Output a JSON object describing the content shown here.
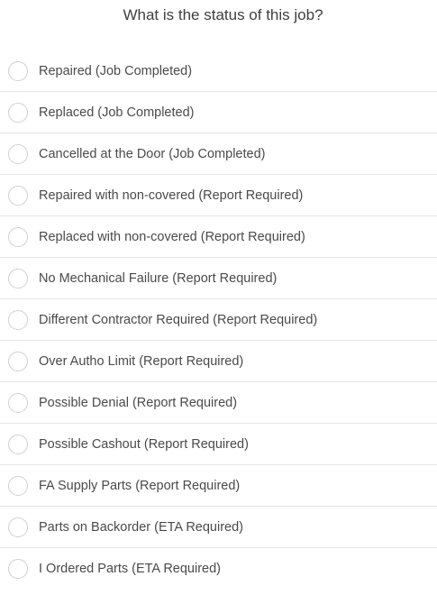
{
  "question": "What is the status of this job?",
  "options": [
    {
      "label": "Repaired (Job Completed)",
      "selected": false
    },
    {
      "label": "Replaced (Job Completed)",
      "selected": false
    },
    {
      "label": "Cancelled at the Door (Job Completed)",
      "selected": false
    },
    {
      "label": "Repaired with non-covered (Report Required)",
      "selected": false
    },
    {
      "label": "Replaced with non-covered (Report Required)",
      "selected": false
    },
    {
      "label": "No Mechanical Failure (Report Required)",
      "selected": false
    },
    {
      "label": "Different Contractor Required (Report Required)",
      "selected": false
    },
    {
      "label": "Over Autho Limit (Report Required)",
      "selected": false
    },
    {
      "label": "Possible Denial (Report Required)",
      "selected": false
    },
    {
      "label": "Possible Cashout (Report Required)",
      "selected": false
    },
    {
      "label": "FA Supply Parts (Report Required)",
      "selected": false
    },
    {
      "label": "Parts on Backorder (ETA Required)",
      "selected": false
    },
    {
      "label": "I Ordered Parts (ETA Required)",
      "selected": false
    }
  ]
}
